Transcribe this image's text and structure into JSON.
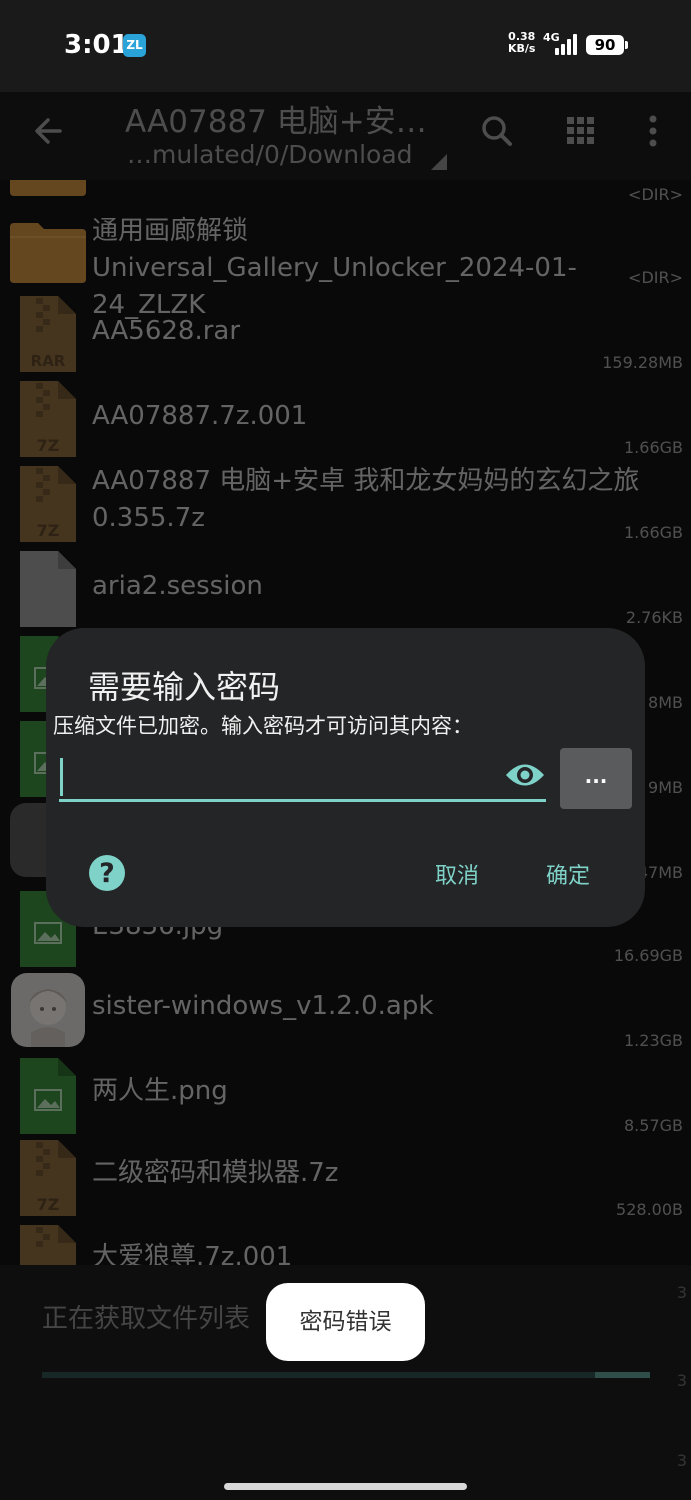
{
  "status_bar": {
    "time": "3:01",
    "app_badge": "ZL",
    "net_speed_value": "0.38",
    "net_speed_unit": "KB/s",
    "network": "4G",
    "battery": "90"
  },
  "toolbar": {
    "title": "AA07887 电脑+安…",
    "subtitle": "…mulated/0/Download",
    "icons": [
      "back-arrow-icon",
      "search-icon",
      "grid-view-icon",
      "more-vert-icon"
    ]
  },
  "files": [
    {
      "name": "",
      "size": "<DIR>",
      "type": "folder"
    },
    {
      "name": "通用画廊解锁Universal_Gallery_Unlocker_2024-01-24_ZLZK",
      "size": "<DIR>",
      "type": "folder"
    },
    {
      "name": "AA5628.rar",
      "size": "159.28MB",
      "type": "rar",
      "badge": "RAR"
    },
    {
      "name": "AA07887.7z.001",
      "size": "1.66GB",
      "type": "7z",
      "badge": "7Z"
    },
    {
      "name": "AA07887 电脑+安卓 我和龙女妈妈的玄幻之旅0.355.7z",
      "size": "1.66GB",
      "type": "7z",
      "badge": "7Z"
    },
    {
      "name": "aria2.session",
      "size": "2.76KB",
      "type": "file"
    },
    {
      "name": "",
      "size": "8MB",
      "type": "image"
    },
    {
      "name": "",
      "size": "9MB",
      "type": "image"
    },
    {
      "name": "",
      "size": "47MB",
      "type": "app"
    },
    {
      "name": "E3836.jpg",
      "size": "16.69GB",
      "type": "image"
    },
    {
      "name": "sister-windows_v1.2.0.apk",
      "size": "1.23GB",
      "type": "apk"
    },
    {
      "name": "两人生.png",
      "size": "8.57GB",
      "type": "image"
    },
    {
      "name": "二级密码和模拟器.7z",
      "size": "528.00B",
      "type": "7z",
      "badge": "7Z"
    },
    {
      "name": "大爱狼尊.7z.001",
      "size": "",
      "type": "7z"
    }
  ],
  "dialog": {
    "title": "需要输入密码",
    "message": "压缩文件已加密。输入密码才可访问其内容：",
    "password_value": "",
    "browse_label": "...",
    "help_label": "?",
    "cancel_label": "取消",
    "ok_label": "确定"
  },
  "progress": {
    "label": "正在获取文件列表",
    "fraction": 0.09,
    "edge_digit": "3"
  },
  "toast": {
    "text": "密码错误"
  },
  "colors": {
    "accent": "#7fd2c8",
    "folder": "#c98e3f",
    "archive": "#8c6a3c",
    "image": "#3a8a3c",
    "dialog_bg": "#242526"
  }
}
